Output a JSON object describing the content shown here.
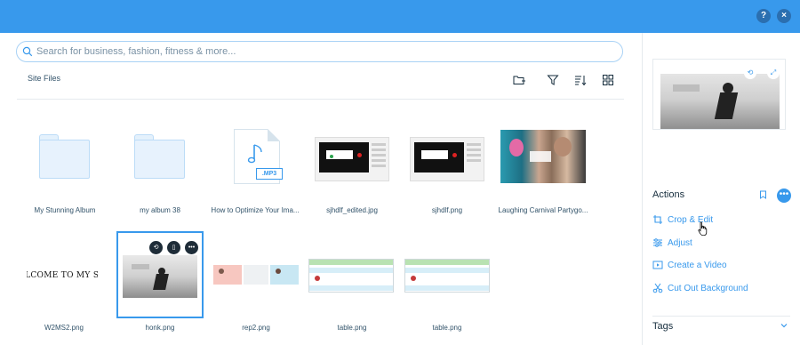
{
  "header": {
    "help_label": "?",
    "close_label": "×"
  },
  "search": {
    "placeholder": "Search for business, fashion, fitness & more..."
  },
  "files_header": {
    "title": "Site Files"
  },
  "grid": {
    "items": [
      {
        "name": "My Stunning Album",
        "type": "folder"
      },
      {
        "name": "my album 38",
        "type": "folder"
      },
      {
        "name": "How to Optimize Your Ima...",
        "type": "audio",
        "badge": ".MP3"
      },
      {
        "name": "sjhdlf_edited.jpg",
        "type": "image"
      },
      {
        "name": "sjhdlf.png",
        "type": "image"
      },
      {
        "name": "Laughing Carnival Partygo...",
        "type": "image"
      },
      {
        "name": "W2MS2.png",
        "type": "image",
        "thumb_text": "WELCOME TO MY SITE"
      },
      {
        "name": "honk.png",
        "type": "image",
        "selected": true
      },
      {
        "name": "rep2.png",
        "type": "image"
      },
      {
        "name": "table.png",
        "type": "image"
      },
      {
        "name": "table.png",
        "type": "image"
      }
    ]
  },
  "side_panel": {
    "actions_title": "Actions",
    "actions": [
      {
        "label": "Crop & Edit",
        "icon": "crop-icon"
      },
      {
        "label": "Adjust",
        "icon": "sliders-icon"
      },
      {
        "label": "Create a Video",
        "icon": "video-icon"
      },
      {
        "label": "Cut Out Background",
        "icon": "scissors-icon"
      }
    ],
    "more_label": "•••",
    "tags_title": "Tags"
  },
  "colors": {
    "accent": "#3899ec",
    "topbar": "#3899ec",
    "text": "#162d3d"
  }
}
